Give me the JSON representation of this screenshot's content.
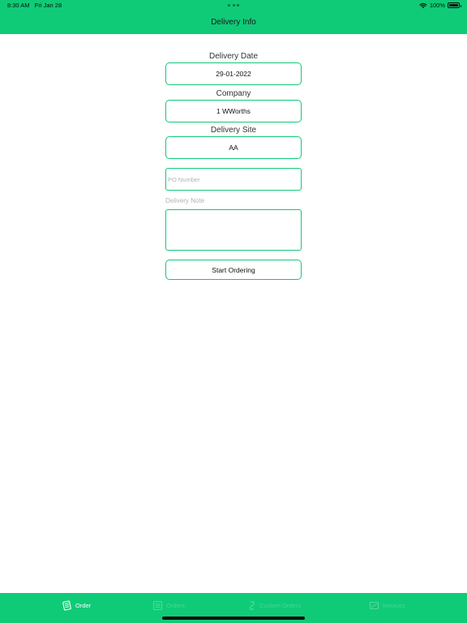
{
  "status_bar": {
    "time": "8:30 AM",
    "date": "Fri Jan 28",
    "battery": "100%"
  },
  "nav": {
    "title": "Delivery Info"
  },
  "form": {
    "delivery_date": {
      "label": "Delivery Date",
      "value": "29-01-2022"
    },
    "company": {
      "label": "Company",
      "value": "1 WWorths"
    },
    "delivery_site": {
      "label": "Delivery Site",
      "value": "AA"
    },
    "po_number": {
      "placeholder": "PO Number",
      "value": ""
    },
    "delivery_note": {
      "label": "Delivery Note",
      "value": ""
    },
    "start_button": {
      "label": "Start Ordering"
    }
  },
  "tabs": [
    {
      "label": "Order",
      "icon": "order-icon",
      "active": true
    },
    {
      "label": "Orders",
      "icon": "orders-icon",
      "active": false
    },
    {
      "label": "Custom Orders",
      "icon": "custom-orders-icon",
      "active": false
    },
    {
      "label": "Invoices",
      "icon": "invoices-icon",
      "active": false
    }
  ],
  "colors": {
    "accent": "#0fcb78",
    "field_border": "#12c877"
  }
}
